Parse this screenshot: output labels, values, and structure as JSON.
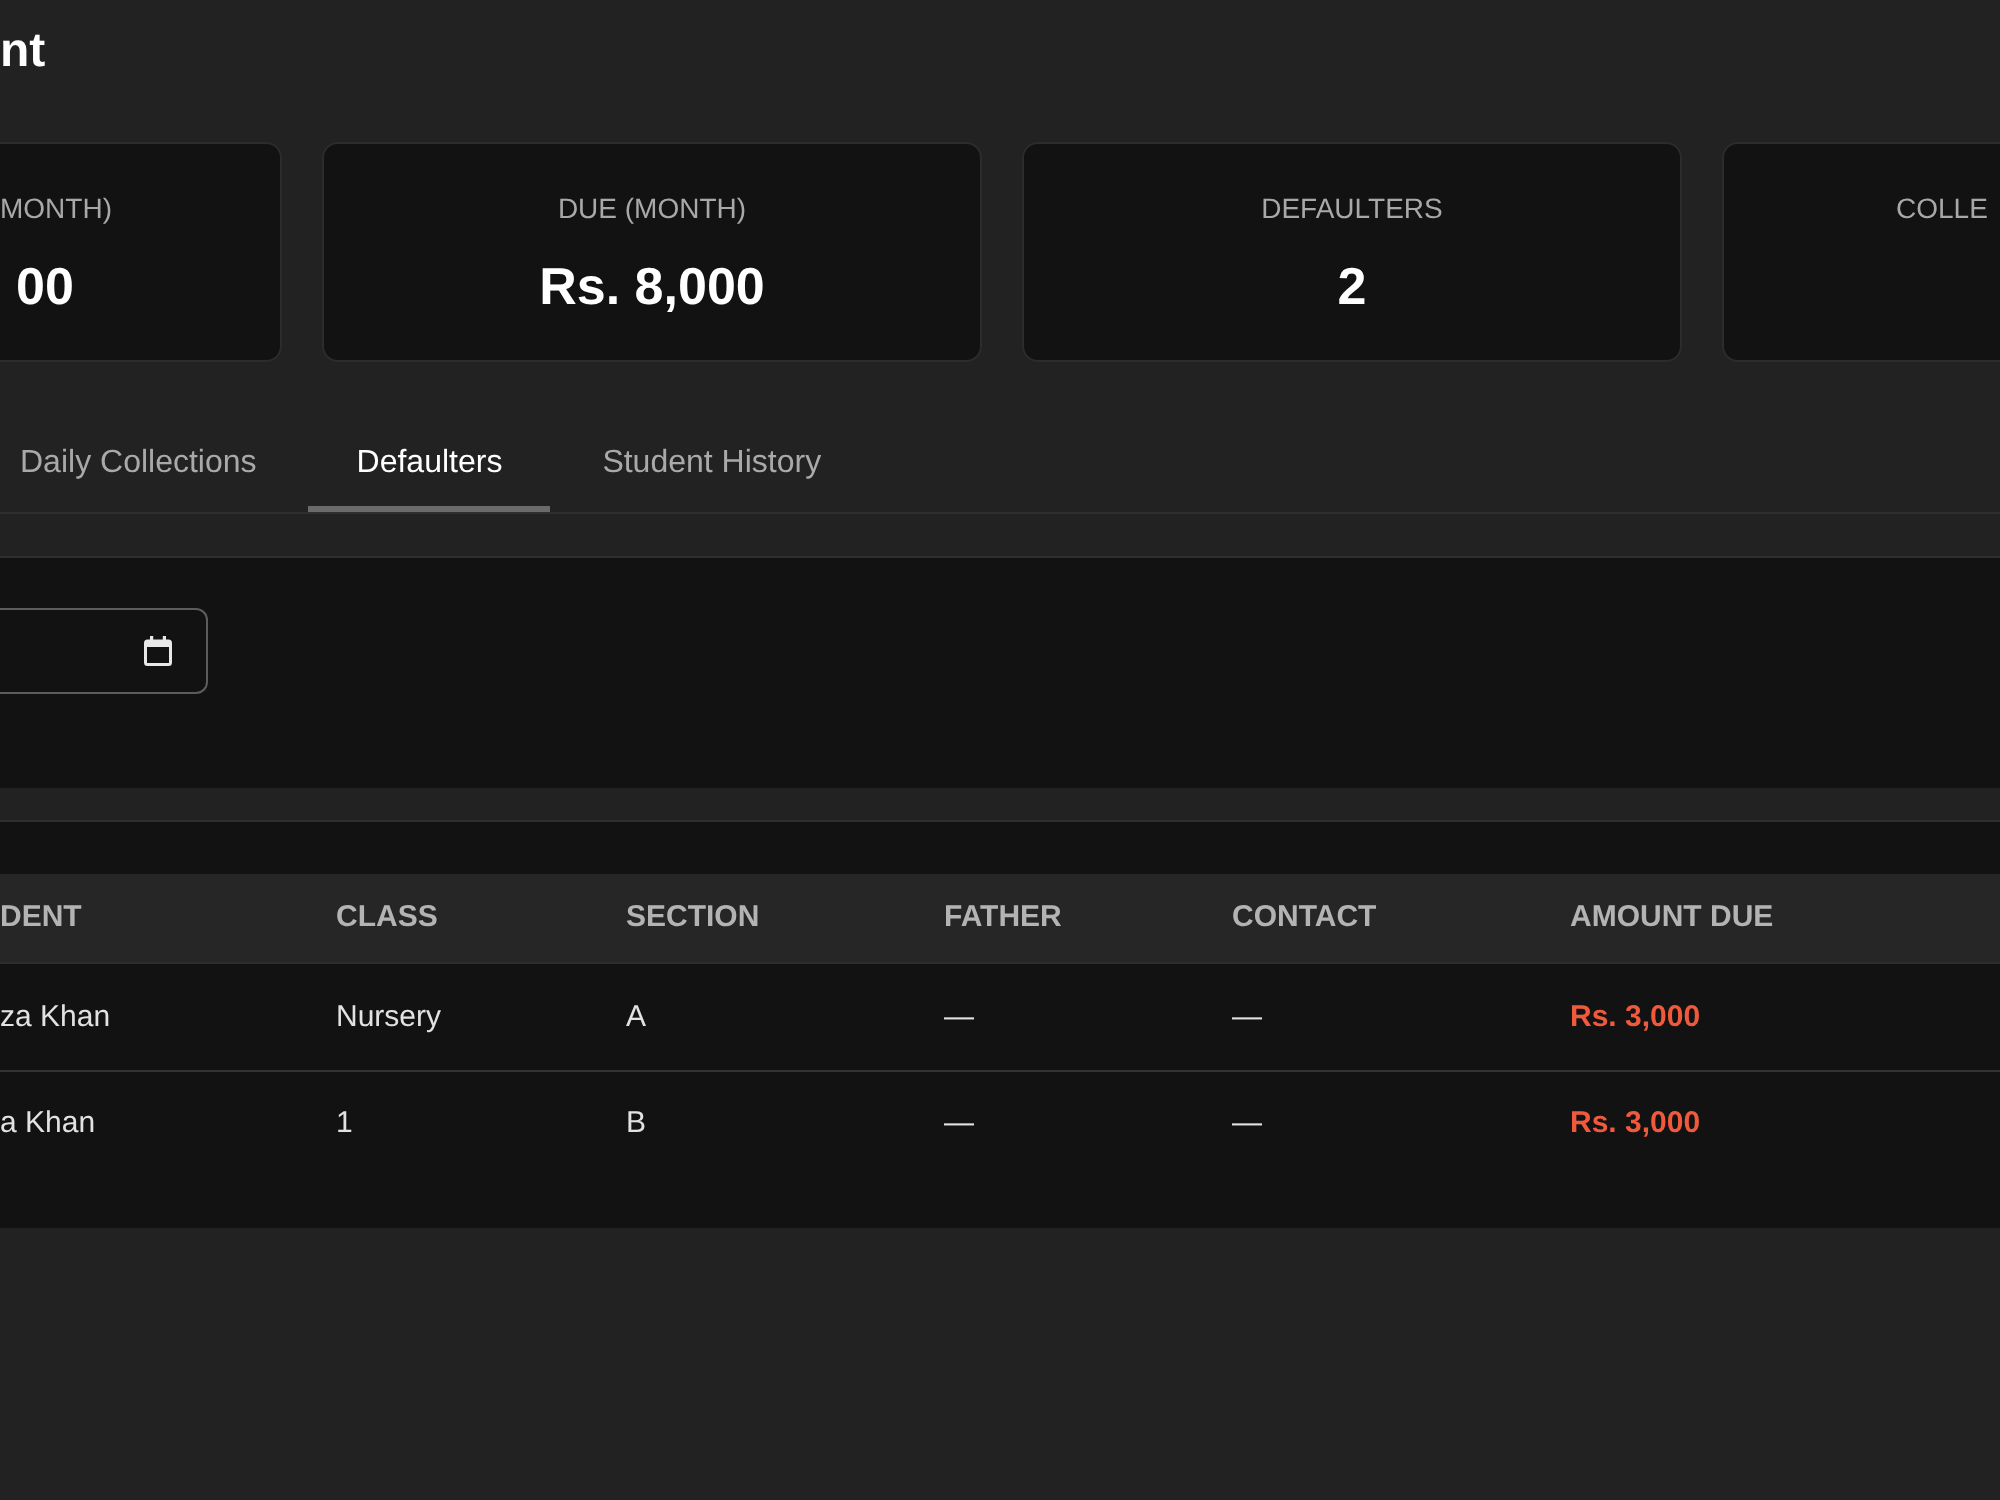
{
  "page": {
    "title": "nt"
  },
  "stats": [
    {
      "label": "MONTH)",
      "value": "00"
    },
    {
      "label": "DUE (MONTH)",
      "value": "Rs. 8,000"
    },
    {
      "label": "DEFAULTERS",
      "value": "2"
    },
    {
      "label": "COLLE"
    }
  ],
  "tabs": [
    {
      "label": "Daily Collections",
      "selected": false
    },
    {
      "label": "Defaulters",
      "selected": true
    },
    {
      "label": "Student History",
      "selected": false
    }
  ],
  "table": {
    "columns": [
      "DENT",
      "CLASS",
      "SECTION",
      "FATHER",
      "CONTACT",
      "AMOUNT DUE"
    ],
    "rows": [
      [
        "za Khan",
        "Nursery",
        "A",
        "—",
        "—",
        "Rs. 3,000"
      ],
      [
        "a Khan",
        "1",
        "B",
        "—",
        "—",
        "Rs. 3,000"
      ]
    ]
  }
}
